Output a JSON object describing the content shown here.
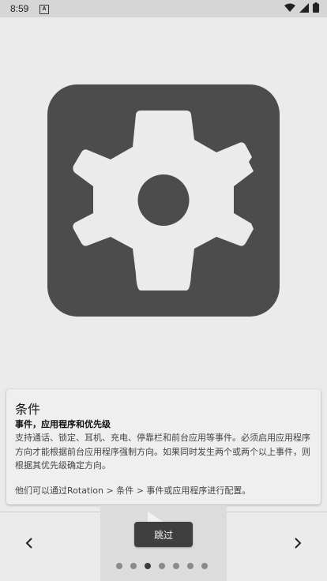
{
  "status_bar": {
    "time": "8:59",
    "notification_icon": "a-icon",
    "icons": [
      "wifi-icon",
      "signal-icon",
      "battery-icon"
    ]
  },
  "hero": {
    "icon": "gear-icon",
    "background_color": "#4c4c4c",
    "foreground_color": "#ebebeb"
  },
  "card": {
    "title": "条件",
    "subtitle": "事件，应用程序和优先级",
    "body": "支持通话、锁定、耳机、充电、停靠栏和前台应用等事件。必须启用应用程序方向才能根据前台应用程序强制方向。如果同时发生两个或两个以上事件，则根据其优先级确定方向。",
    "footer": "他们可以通过Rotation > 条件 > 事件或应用程序进行配置。"
  },
  "bottom": {
    "skip_label": "跳过",
    "prev_icon": "chevron-left-icon",
    "next_icon": "chevron-right-icon",
    "page_count": 7,
    "active_page": 3
  }
}
